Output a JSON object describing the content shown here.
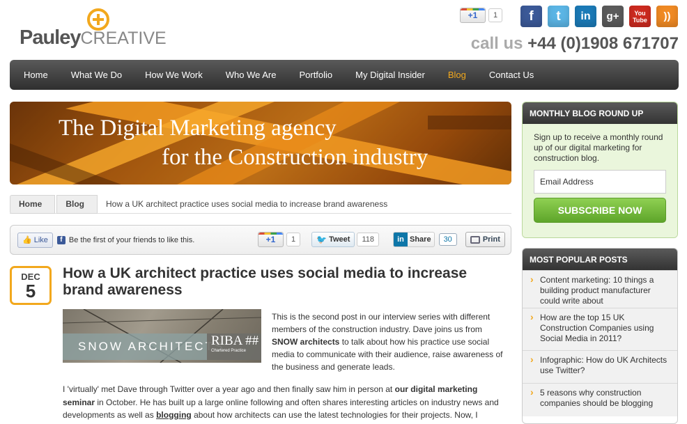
{
  "header": {
    "logo_main": "Pauley",
    "logo_sub": "CREATIVE",
    "gplus_label": "+1",
    "gplus_count": "1",
    "social": [
      "facebook-icon",
      "twitter-icon",
      "linkedin-icon",
      "google-plus-icon",
      "youtube-icon",
      "rss-icon"
    ],
    "social_glyphs": {
      "fb": "f",
      "tw": "t",
      "in": "in",
      "gp": "g+",
      "yt": "You Tube",
      "rss": "))"
    },
    "call_label": "call us",
    "phone": "+44 (0)1908 671707"
  },
  "nav": {
    "items": [
      "Home",
      "What We Do",
      "How We Work",
      "Who We Are",
      "Portfolio",
      "My Digital Insider",
      "Blog",
      "Contact Us"
    ],
    "active": "Blog"
  },
  "banner": {
    "line1": "The Digital Marketing agency",
    "line2": "for the Construction industry"
  },
  "breadcrumb": {
    "home": "Home",
    "blog": "Blog",
    "current": "How a UK architect practice uses social media to increase brand awareness"
  },
  "share": {
    "like": "Like",
    "fb_text": "Be the first of your friends to like this.",
    "gplus_label": "+1",
    "gplus_count": "1",
    "tweet": "Tweet",
    "tweet_count": "118",
    "linkedin": "Share",
    "linkedin_count": "30",
    "print": "Print"
  },
  "post": {
    "month": "DEC",
    "day": "5",
    "title": "How a UK architect practice uses social media to increase brand awareness",
    "image_snow": "SNOW ARCHITECTS",
    "image_riba": "RIBA ##",
    "image_riba_sub": "Chartered Practice",
    "intro_1": "This is the second post in our interview series with different members of the construction industry. Dave joins us from ",
    "intro_link": "SNOW architects",
    "intro_2": " to talk about how his practice use social media to communicate with their audience, raise awareness of the business and generate leads.",
    "body_1": "I 'virtually' met Dave through Twitter over a year ago and then finally saw him in person at ",
    "body_link1": "our digital marketing seminar",
    "body_2": " in October. He has built up a large online following and often shares interesting articles on industry news and developments as well as ",
    "body_link2": "blogging",
    "body_3": " about how architects can use the latest technologies for their projects. Now, I"
  },
  "sidebar": {
    "newsletter_title": "MONTHLY BLOG ROUND UP",
    "newsletter_text": "Sign up to receive a monthly round up of our digital marketing for construction blog.",
    "email_placeholder": "Email Address",
    "subscribe": "SUBSCRIBE NOW",
    "popular_title": "MOST POPULAR POSTS",
    "popular": [
      "Content marketing: 10 things a building product manufacturer could write about",
      "How are the top 15 UK Construction Companies using Social Media in 2011?",
      "Infographic: How do UK Architects use Twitter?",
      "5 reasons why construction companies should be blogging"
    ]
  },
  "colors": {
    "accent": "#f2a81d",
    "nav_dark": "#333333",
    "subscribe_green": "#6fb83a"
  }
}
